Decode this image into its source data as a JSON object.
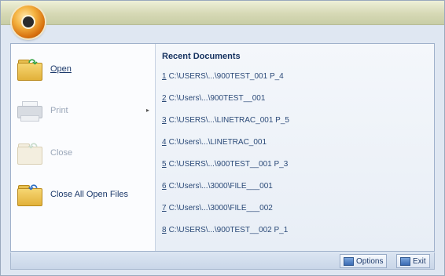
{
  "menu": {
    "commands": [
      {
        "label": "Open",
        "icon": "open-folder-icon",
        "enabled": true
      },
      {
        "label": "Print",
        "icon": "printer-icon",
        "enabled": false,
        "has_submenu": true
      },
      {
        "label": "Close",
        "icon": "close-folder-icon",
        "enabled": false
      },
      {
        "label": "Close All Open Files",
        "icon": "close-all-folder-icon",
        "enabled": true
      }
    ],
    "submenu_arrow": "▸"
  },
  "recent": {
    "title": "Recent Documents",
    "items": [
      {
        "num": "1",
        "path": "C:\\USERS\\...\\900TEST_001 P_4"
      },
      {
        "num": "2",
        "path": "C:\\Users\\...\\900TEST__001"
      },
      {
        "num": "3",
        "path": "C:\\USERS\\...\\LINETRAC_001 P_5"
      },
      {
        "num": "4",
        "path": "C:\\Users\\...\\LINETRAC_001"
      },
      {
        "num": "5",
        "path": "C:\\USERS\\...\\900TEST__001 P_3"
      },
      {
        "num": "6",
        "path": "C:\\Users\\...\\3000\\FILE___001"
      },
      {
        "num": "7",
        "path": "C:\\Users\\...\\3000\\FILE___002"
      },
      {
        "num": "8",
        "path": "C:\\USERS\\...\\900TEST__002 P_1"
      }
    ]
  },
  "footer": {
    "options_label": "Options",
    "exit_label": "Exit"
  }
}
